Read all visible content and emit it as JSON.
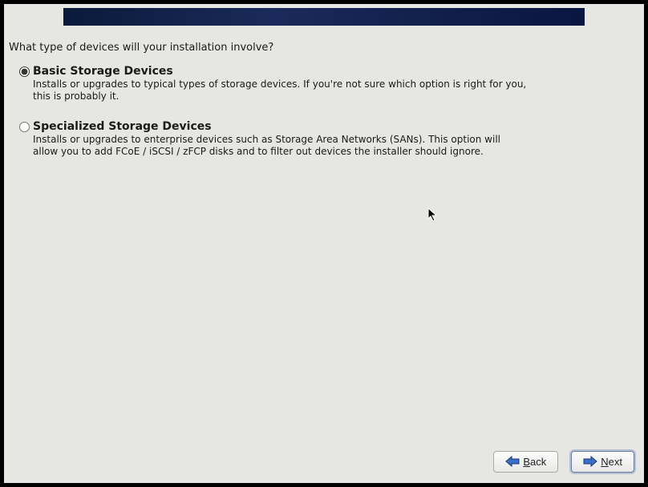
{
  "prompt": "What type of devices will your installation involve?",
  "options": {
    "basic": {
      "title": "Basic Storage Devices",
      "desc": "Installs or upgrades to typical types of storage devices.  If you're not sure which option is right for you, this is probably it.",
      "selected": true
    },
    "specialized": {
      "title": "Specialized Storage Devices",
      "desc": "Installs or upgrades to enterprise devices such as Storage Area Networks (SANs). This option will allow you to add FCoE / iSCSI / zFCP disks and to filter out devices the installer should ignore.",
      "selected": false
    }
  },
  "buttons": {
    "back": "Back",
    "next": "Next"
  }
}
